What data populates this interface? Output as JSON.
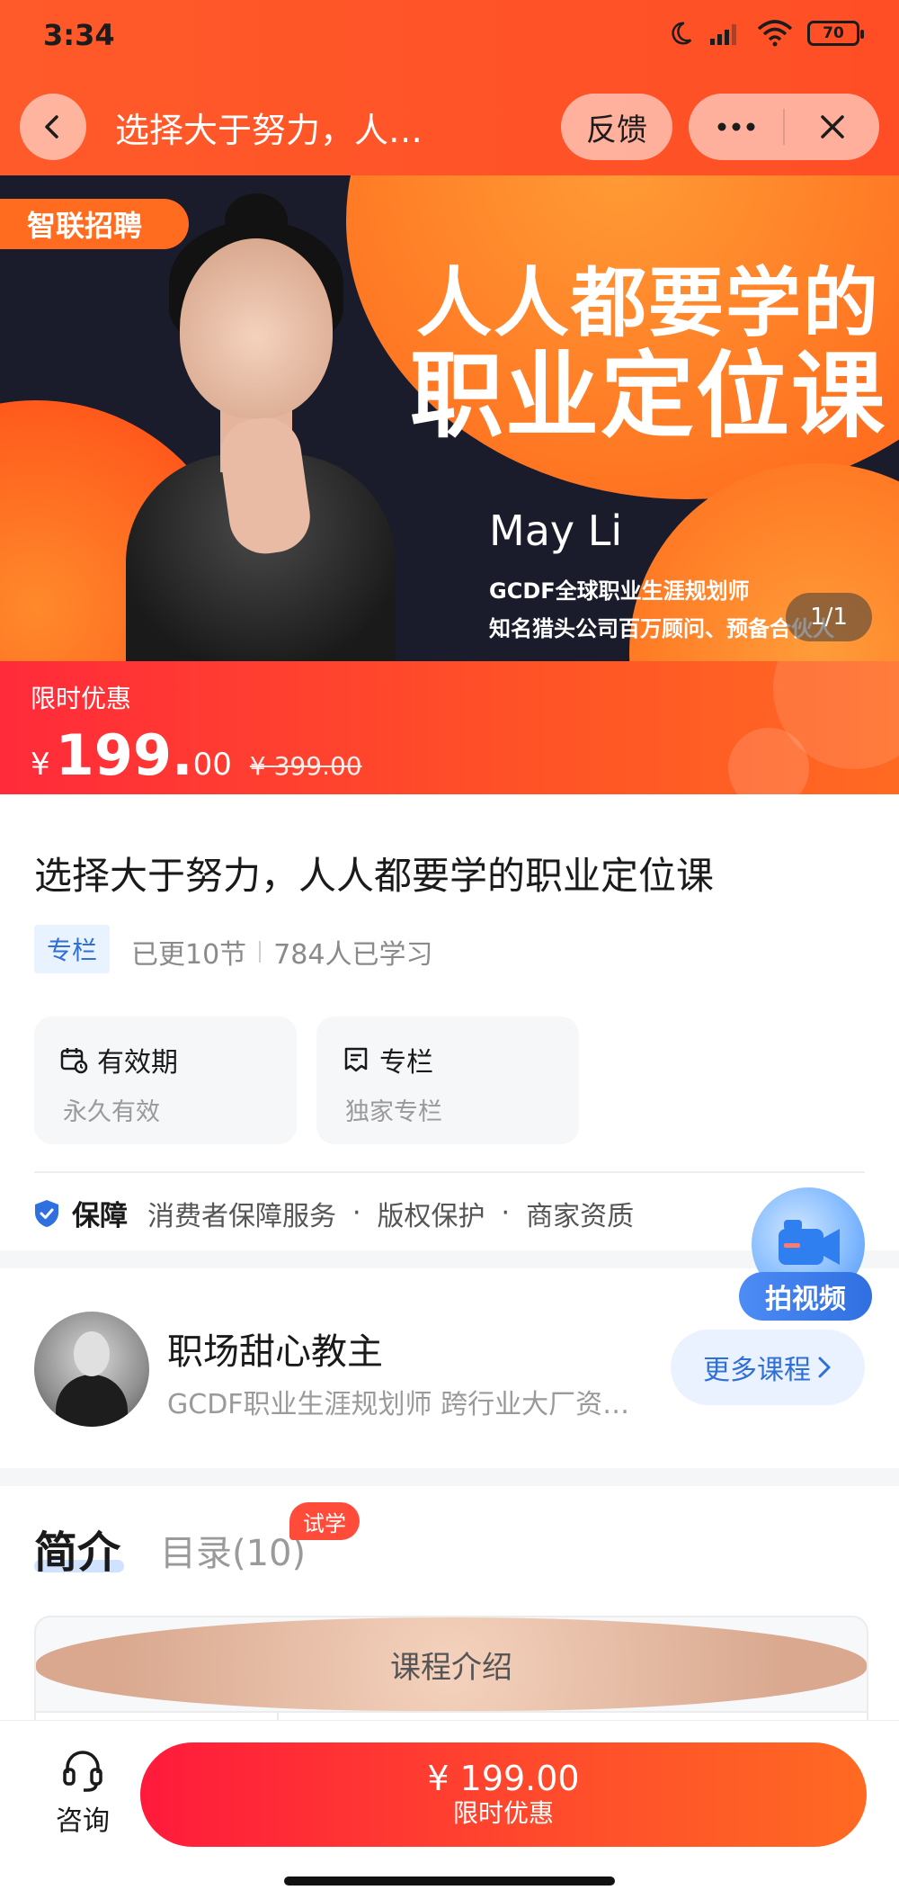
{
  "status_bar": {
    "time": "3:34",
    "battery": "70"
  },
  "nav": {
    "title": "选择大于努力，人…",
    "feedback_label": "反馈"
  },
  "banner": {
    "brand": "智联招聘",
    "headline_line1": "人人都要学的",
    "headline_line2": "职业定位课",
    "name": "May Li",
    "credential1": "GCDF全球职业生涯规划师",
    "credential2": "知名猎头公司百万顾问、预备合伙人",
    "pager": "1/1"
  },
  "price_strip": {
    "label": "限时优惠",
    "currency": "¥",
    "price_int": "199.",
    "price_dec": "00",
    "original": "¥ 399.00"
  },
  "course": {
    "title": "选择大于努力，人人都要学的职业定位课",
    "tag": "专栏",
    "updated": "已更10节",
    "learners": "784人已学习",
    "cards": [
      {
        "title": "有效期",
        "sub": "永久有效"
      },
      {
        "title": "专栏",
        "sub": "独家专栏"
      }
    ],
    "guarantee": {
      "title": "保障",
      "items": [
        "消费者保障服务",
        "版权保护",
        "商家资质"
      ],
      "dot": "·"
    }
  },
  "float_video": {
    "label": "拍视频"
  },
  "author": {
    "name": "职场甜心教主",
    "desc": "GCDF职业生涯规划师 跨行业大厂资深…",
    "more_label": "更多课程"
  },
  "tabs": {
    "intro": "简介",
    "catalog": "目录(10)",
    "trial_badge": "试学"
  },
  "intro_card": {
    "heading": "课程介绍"
  },
  "bottom_bar": {
    "consult_label": "咨询",
    "buy_price": "¥ 199.00",
    "buy_sub": "限时优惠"
  },
  "colors": {
    "primary_orange": "#ff5a2a",
    "price_red": "#ff2a3a",
    "link_blue": "#2f6fd8"
  }
}
